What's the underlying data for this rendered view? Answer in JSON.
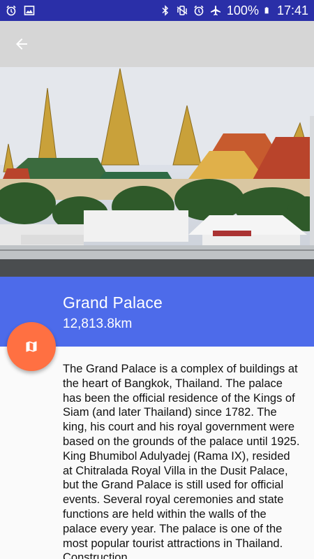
{
  "status_bar": {
    "battery": "100%",
    "time": "17:41",
    "icons": [
      "alarm-icon",
      "image-icon",
      "bluetooth-icon",
      "vibrate-icon",
      "alarm-icon",
      "airplane-icon",
      "battery-icon"
    ]
  },
  "app_bar": {
    "back_icon": "arrow-back-icon"
  },
  "place": {
    "title": "Grand Palace",
    "distance": "12,813.8km",
    "description": "The Grand Palace is a complex of buildings at the heart of Bangkok, Thailand. The palace has been the official residence of the Kings of Siam (and later Thailand) since 1782. The king, his court and his royal government were based on the grounds of the palace until 1925. King Bhumibol Adulyadej (Rama IX), resided at Chitralada Royal Villa in the Dusit Palace, but the Grand Palace is still used for official events. Several royal ceremonies and state functions are held within the walls of the palace every year. The palace is one of the most popular tourist attractions in Thailand. Construction"
  },
  "fab": {
    "icon": "map-icon"
  },
  "colors": {
    "status_bar": "#2a2fa8",
    "app_bar": "#d6d6d6",
    "title_panel": "#4d6bea",
    "fab": "#ff7042"
  }
}
